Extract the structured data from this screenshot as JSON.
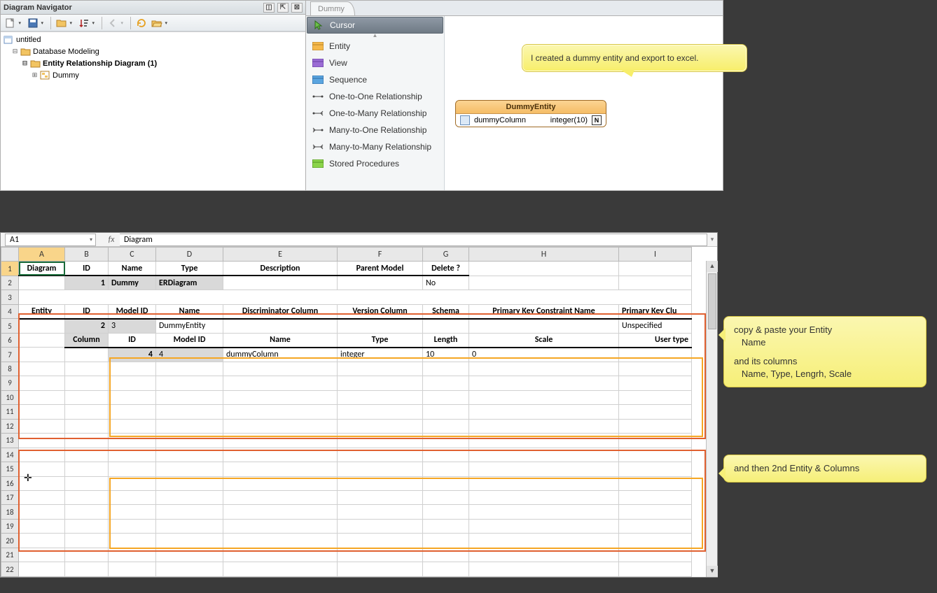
{
  "navigator": {
    "title": "Diagram Navigator",
    "tree": {
      "root": "untitled",
      "node1": "Database Modeling",
      "node2": "Entity Relationship Diagram (1)",
      "node3": "Dummy"
    }
  },
  "tabstrip": {
    "tab1": "Dummy"
  },
  "palette": {
    "cursor": "Cursor",
    "entity": "Entity",
    "view": "View",
    "sequence": "Sequence",
    "oneone": "One-to-One Relationship",
    "onemany": "One-to-Many Relationship",
    "manyone": "Many-to-One Relationship",
    "manymany": "Many-to-Many Relationship",
    "stored": "Stored Procedures"
  },
  "canvas": {
    "note1": "I created a dummy entity and export to excel.",
    "entity": {
      "name": "DummyEntity",
      "col_name": "dummyColumn",
      "col_type": "integer(10)",
      "nullable": "N"
    }
  },
  "excel": {
    "cellref": "A1",
    "formula": "Diagram",
    "cols": [
      "A",
      "B",
      "C",
      "D",
      "E",
      "F",
      "G",
      "H",
      "I"
    ],
    "rows": [
      "1",
      "2",
      "3",
      "4",
      "5",
      "6",
      "7",
      "8",
      "9",
      "10",
      "11",
      "12",
      "13",
      "14",
      "15",
      "16",
      "17",
      "18",
      "19",
      "20",
      "21",
      "22"
    ],
    "h1": {
      "A": "Diagram",
      "B": "ID",
      "C": "Name",
      "D": "Type",
      "E": "Description",
      "F": "Parent Model",
      "G": "Delete ?"
    },
    "r2": {
      "B": "1",
      "C": "Dummy",
      "D": "ERDiagram",
      "G": "No"
    },
    "h4": {
      "A": "Entity",
      "B": "ID",
      "C": "Model ID",
      "D": "Name",
      "E": "Discriminator Column",
      "F": "Version Column",
      "G": "Schema",
      "H": "Primary Key Constraint Name",
      "I": "Primary Key Clu"
    },
    "r5": {
      "B": "2",
      "C": "3",
      "D": "DummyEntity",
      "I": "Unspecified"
    },
    "h6": {
      "B": "Column",
      "C": "ID",
      "D": "Model ID",
      "E": "Name",
      "F": "Type",
      "G": "Length",
      "H": "Scale",
      "I": "User type"
    },
    "r7": {
      "C": "4",
      "D": "4",
      "E": "dummyColumn",
      "F": "integer",
      "G": "10",
      "H": "0"
    }
  },
  "annot": {
    "a1_l1": "copy & paste your Entity",
    "a1_l2": "   Name",
    "a1_l3": "",
    "a1_l4": "and its columns",
    "a1_l5": "   Name, Type, Lengrh, Scale",
    "a2": "and then 2nd Entity & Columns"
  }
}
